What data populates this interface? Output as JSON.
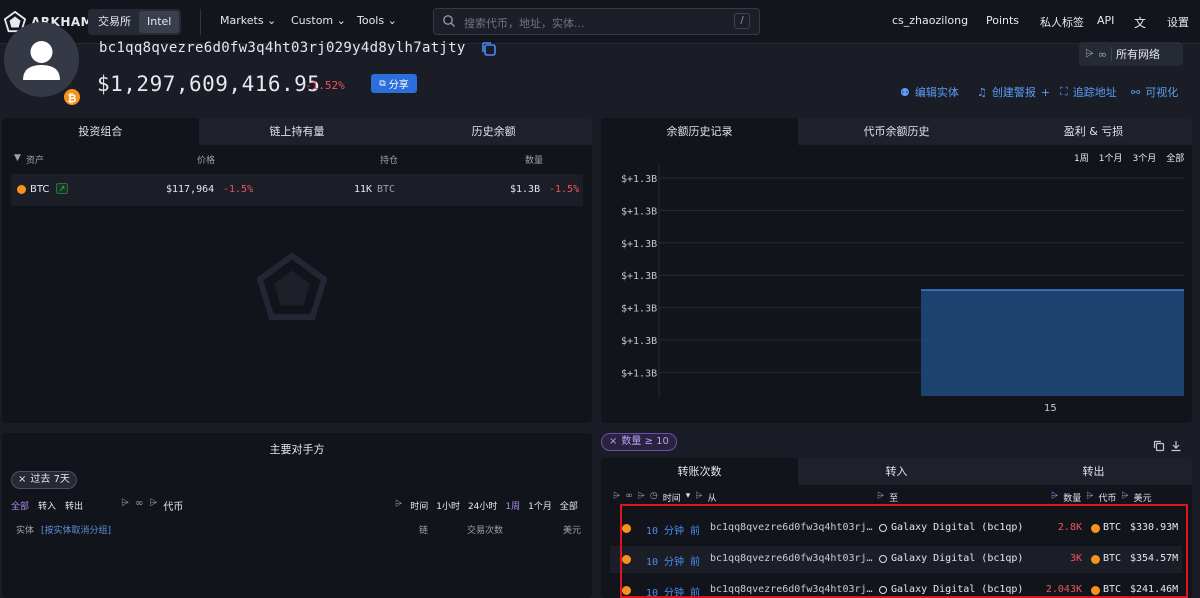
{
  "brand": {
    "name": "ARKHAM"
  },
  "topnav": {
    "exchange": "交易所",
    "intel": "Intel",
    "markets": "Markets",
    "custom": "Custom",
    "tools": "Tools",
    "search_placeholder": "搜索代币，地址，实体...",
    "search_shortcut": "/",
    "user": "cs_zhaozilong",
    "points": "Points",
    "private_labels": "私人标签",
    "api": "API",
    "settings": "设置"
  },
  "profile": {
    "address": "bc1qq8qvezre6d0fw3q4ht03rj029y4d8ylh7atjty",
    "balance": "$1,297,609,416.95",
    "change": "-1.52%",
    "share": "分享",
    "network": "所有网络",
    "actions": {
      "edit_entity": "编辑实体",
      "create_alert": "创建警报",
      "plus": "+",
      "track": "追踪地址",
      "visualize": "可视化"
    }
  },
  "portfolio": {
    "tabs": [
      "投资组合",
      "链上持有量",
      "历史余额"
    ],
    "headers": {
      "asset": "资产",
      "price": "价格",
      "holdings": "持仓",
      "amount": "数量"
    },
    "row": {
      "asset": "BTC",
      "price": "$117,964",
      "price_change": "-1.5%",
      "holdings": "11K",
      "holdings_unit": "BTC",
      "value": "$1.3B",
      "value_change": "-1.5%"
    }
  },
  "balance_chart": {
    "tabs": [
      "余额历史记录",
      "代币余额历史",
      "盈利 & 亏损"
    ],
    "ranges": [
      "1周",
      "1个月",
      "3个月",
      "全部"
    ]
  },
  "chart_data": {
    "type": "area",
    "y_tick_labels": [
      "$+1.3B",
      "$+1.3B",
      "$+1.3B",
      "$+1.3B",
      "$+1.3B",
      "$+1.3B",
      "$+1.3B"
    ],
    "x": [
      "15"
    ],
    "values": [
      1297609416.95
    ],
    "grid": true,
    "color": "#1f4a7e"
  },
  "counterparties": {
    "title": "主要对手方",
    "filter_chip": "过去 7天",
    "flow": [
      "全部",
      "转入",
      "转出"
    ],
    "token_label": "代币",
    "time_label": "时间",
    "ranges": [
      "1小时",
      "24小时",
      "1周",
      "1个月",
      "全部"
    ],
    "headers": {
      "entity": "实体",
      "ungroup": "[按实体取消分组]",
      "chain": "链",
      "tx_count": "交易次数",
      "usd": "美元"
    }
  },
  "transfers": {
    "filter_chip": "数量 ≥ 10",
    "tabs": [
      "转账次数",
      "转入",
      "转出"
    ],
    "headers": {
      "time": "时间",
      "from": "从",
      "to": "至",
      "amount": "数量",
      "token": "代币",
      "usd": "美元"
    },
    "rows": [
      {
        "time": "10 分钟 前",
        "from": "bc1qq8qvezre6d0fw3q4ht03rj…",
        "to": "Galaxy Digital (bc1qp)",
        "amount": "2.8K",
        "token": "BTC",
        "usd": "$330.93M"
      },
      {
        "time": "10 分钟 前",
        "from": "bc1qq8qvezre6d0fw3q4ht03rj…",
        "to": "Galaxy Digital (bc1qp)",
        "amount": "3K",
        "token": "BTC",
        "usd": "$354.57M"
      },
      {
        "time": "10 分钟 前",
        "from": "bc1qq8qvezre6d0fw3q4ht03rj…",
        "to": "Galaxy Digital (bc1qp)",
        "amount": "2.043K",
        "token": "BTC",
        "usd": "$241.46M"
      }
    ]
  },
  "colors": {
    "accent": "#4b8cf5",
    "negative": "#f2545b",
    "btc": "#f7931a",
    "highlight": "#e0141e"
  }
}
